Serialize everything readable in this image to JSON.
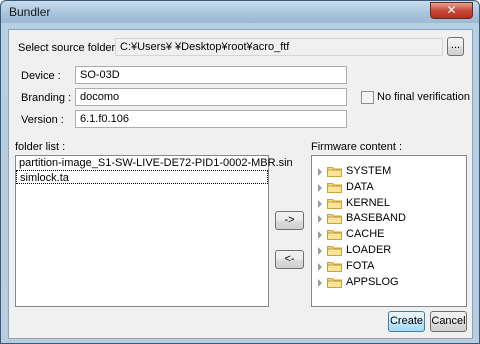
{
  "window": {
    "title": "Bundler",
    "close_glyph": "✕"
  },
  "source": {
    "label": "Select source folder",
    "path": "C:¥Users¥            ¥Desktop¥root¥acro_ftf",
    "browse_label": "..."
  },
  "device": {
    "label": "Device :",
    "value": "SO-03D"
  },
  "branding": {
    "label": "Branding :",
    "value": "docomo"
  },
  "version": {
    "label": "Version :",
    "value": "6.1.f0.106"
  },
  "no_final_verification": {
    "label": "No final verification",
    "checked": false
  },
  "folder_list": {
    "label": "folder list :",
    "items": [
      "partition-image_S1-SW-LIVE-DE72-PID1-0002-MBR.sin",
      "simlock.ta"
    ]
  },
  "firmware": {
    "label": "Firmware content :",
    "items": [
      "SYSTEM",
      "DATA",
      "KERNEL",
      "BASEBAND",
      "CACHE",
      "LOADER",
      "FOTA",
      "APPSLOG"
    ]
  },
  "buttons": {
    "add": "->",
    "remove": "<-",
    "create": "Create",
    "cancel": "Cancel"
  },
  "icons": {
    "folder": "folder-icon",
    "expand": "tree-expand-icon"
  }
}
